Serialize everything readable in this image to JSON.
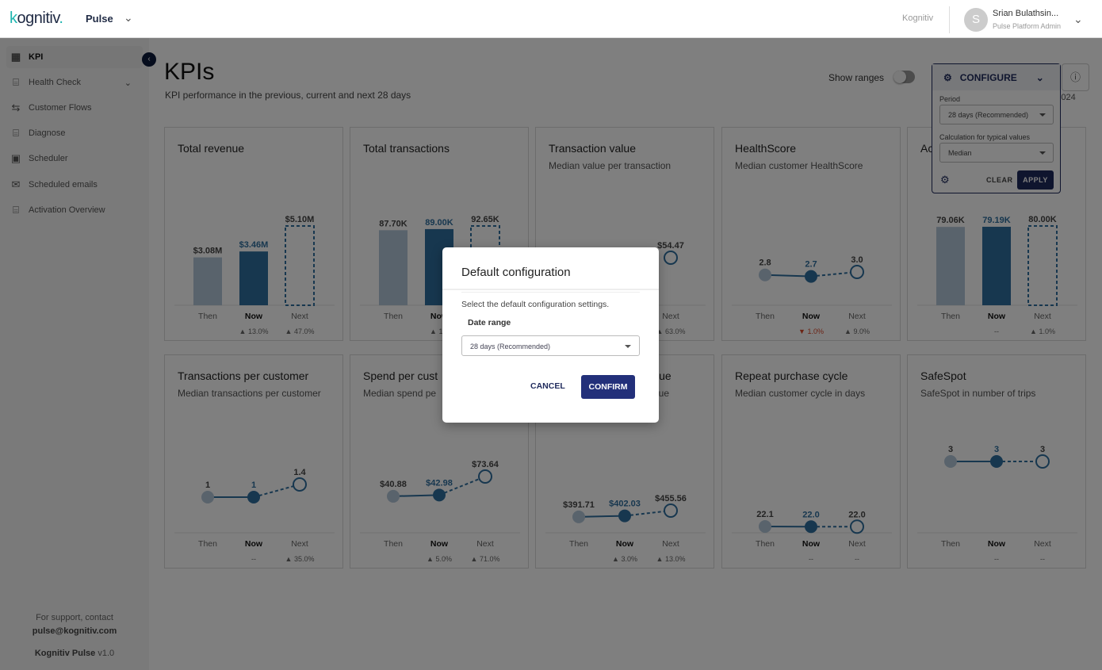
{
  "topbar": {
    "logo": "kognitiv",
    "app": "Pulse",
    "org": "Kognitiv",
    "user_initial": "S",
    "user_name": "Srian Bulathsin...",
    "user_role": "Pulse Platform Admin"
  },
  "sidebar": {
    "items": [
      {
        "label": "KPI",
        "icon": "grid-icon",
        "active": true
      },
      {
        "label": "Health Check",
        "icon": "clipboard-pulse-icon",
        "expandable": true
      },
      {
        "label": "Customer Flows",
        "icon": "flow-icon"
      },
      {
        "label": "Diagnose",
        "icon": "clipboard-pulse-icon"
      },
      {
        "label": "Scheduler",
        "icon": "calendar-icon"
      },
      {
        "label": "Scheduled emails",
        "icon": "mail-icon"
      },
      {
        "label": "Activation Overview",
        "icon": "clipboard-pulse-icon"
      }
    ],
    "support_text": "For support, contact",
    "support_email": "pulse@kognitiv.com",
    "product": "Kognitiv Pulse",
    "version": "v1.0"
  },
  "page": {
    "title": "KPIs",
    "subtitle": "KPI performance in the previous, current and next 28 days",
    "show_ranges": "Show ranges",
    "show_ranges_on": false,
    "date_fragment": "5, 2024"
  },
  "configure": {
    "label": "CONFIGURE",
    "period_label": "Period",
    "period_value": "28 days (Recommended)",
    "calc_label": "Calculation for typical values",
    "calc_value": "Median",
    "clear": "CLEAR",
    "apply": "APPLY"
  },
  "colors": {
    "then": "#b3c6d8",
    "now": "#2f6f9f",
    "up": "#4a7fa8",
    "down": "#d9482b",
    "navy": "#1f2a5c"
  },
  "axis": [
    "Then",
    "Now",
    "Next"
  ],
  "cards": [
    {
      "title": "Total revenue",
      "subtitle": "",
      "type": "bar",
      "labels": [
        "$3.08M",
        "$3.46M",
        "$5.10M"
      ],
      "values": [
        3.08,
        3.46,
        5.1
      ],
      "changes": [
        "",
        "▲ 13.0%",
        "▲ 47.0%"
      ]
    },
    {
      "title": "Total transactions",
      "subtitle": "",
      "type": "bar",
      "labels": [
        "87.70K",
        "89.00K",
        "92.65K"
      ],
      "values": [
        87.7,
        89.0,
        92.65
      ],
      "changes": [
        "",
        "▲ 1.0",
        "▲"
      ]
    },
    {
      "title": "Transaction value",
      "subtitle": "Median value per transaction",
      "type": "line",
      "labels": [
        "",
        "",
        "$54.47"
      ],
      "values": [
        null,
        null,
        54.47
      ],
      "changes": [
        "",
        "",
        "▲ 63.0%"
      ]
    },
    {
      "title": "HealthScore",
      "subtitle": "Median customer HealthScore",
      "type": "line",
      "labels": [
        "2.8",
        "2.7",
        "3.0"
      ],
      "values": [
        2.8,
        2.7,
        3.0
      ],
      "changes": [
        "",
        "▼ 1.0%",
        "▲ 9.0%"
      ]
    },
    {
      "title": "Ac",
      "subtitle": "",
      "type": "bar",
      "labels": [
        "79.06K",
        "79.19K",
        "80.00K"
      ],
      "values": [
        79.06,
        79.19,
        80.0
      ],
      "changes": [
        "",
        "--",
        "▲ 1.0%"
      ]
    },
    {
      "title": "Transactions per customer",
      "subtitle": "Median transactions per customer",
      "type": "line",
      "labels": [
        "1",
        "1",
        "1.4"
      ],
      "values": [
        1,
        1,
        1.4
      ],
      "changes": [
        "",
        "--",
        "▲ 35.0%"
      ]
    },
    {
      "title": "Spend per cust",
      "subtitle": "Median spend pe",
      "type": "line",
      "labels": [
        "$40.88",
        "$42.98",
        "$73.64"
      ],
      "values": [
        40.88,
        42.98,
        73.64
      ],
      "changes": [
        "",
        "▲ 5.0%",
        "▲ 71.0%"
      ]
    },
    {
      "title": "lue",
      "subtitle": "lue",
      "type": "line",
      "labels": [
        "$391.71",
        "$402.03",
        "$455.56"
      ],
      "values": [
        391.71,
        402.03,
        455.56
      ],
      "changes": [
        "",
        "▲ 3.0%",
        "▲ 13.0%"
      ]
    },
    {
      "title": "Repeat purchase cycle",
      "subtitle": "Median customer cycle in days",
      "type": "line",
      "labels": [
        "22.1",
        "22.0",
        "22.0"
      ],
      "values": [
        22.1,
        22.0,
        22.0
      ],
      "changes": [
        "",
        "--",
        "--"
      ]
    },
    {
      "title": "SafeSpot",
      "subtitle": "SafeSpot in number of trips",
      "type": "line",
      "labels": [
        "3",
        "3",
        "3"
      ],
      "values": [
        3,
        3,
        3
      ],
      "changes": [
        "",
        "--",
        "--"
      ]
    }
  ],
  "modal": {
    "title": "Default configuration",
    "description": "Select the default configuration settings.",
    "field_label": "Date range",
    "field_value": "28 days (Recommended)",
    "cancel": "CANCEL",
    "confirm": "CONFIRM"
  }
}
